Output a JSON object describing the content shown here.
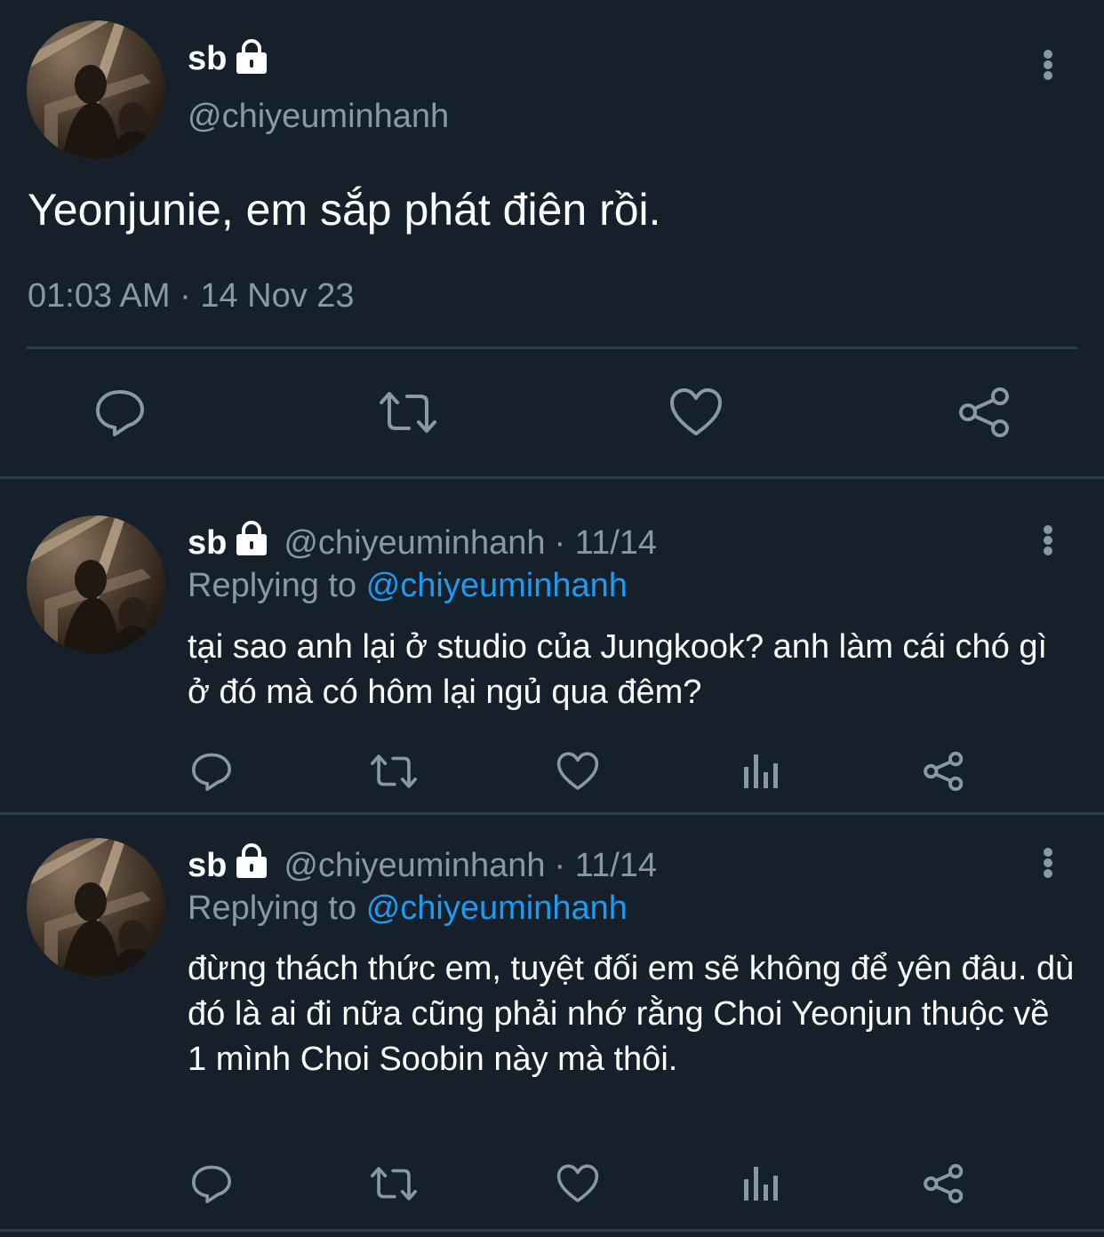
{
  "main_tweet": {
    "display_name": "sb",
    "handle": "@chiyeuminhanh",
    "text": "Yeonjunie, em sắp phát điên rồi.",
    "timestamp": "01:03 AM · 14 Nov 23",
    "locked_icon": "lock-icon",
    "actions": [
      "reply-icon",
      "retweet-icon",
      "like-icon",
      "share-icon"
    ]
  },
  "replies": [
    {
      "display_name": "sb",
      "handle": "@chiyeuminhanh",
      "date": "· 11/14",
      "replying_label": "Replying to",
      "replying_to": "@chiyeuminhanh",
      "text": "tại sao anh lại ở studio của Jungkook? anh làm cái chó gì ở đó mà có hôm lại ngủ qua đêm?"
    },
    {
      "display_name": "sb",
      "handle": "@chiyeuminhanh",
      "date": "· 11/14",
      "replying_label": "Replying to",
      "replying_to": "@chiyeuminhanh",
      "text": "đừng thách thức em, tuyệt đối em sẽ không để yên đâu. dù đó là ai đi nữa cũng phải nhớ rằng Choi Yeonjun thuộc về 1 mình Choi Soobin này mà thôi."
    }
  ],
  "colors": {
    "background": "#15202b",
    "text": "#ffffff",
    "muted": "#8899a6",
    "link": "#1d9bf0",
    "divider": "#2f3b47"
  }
}
